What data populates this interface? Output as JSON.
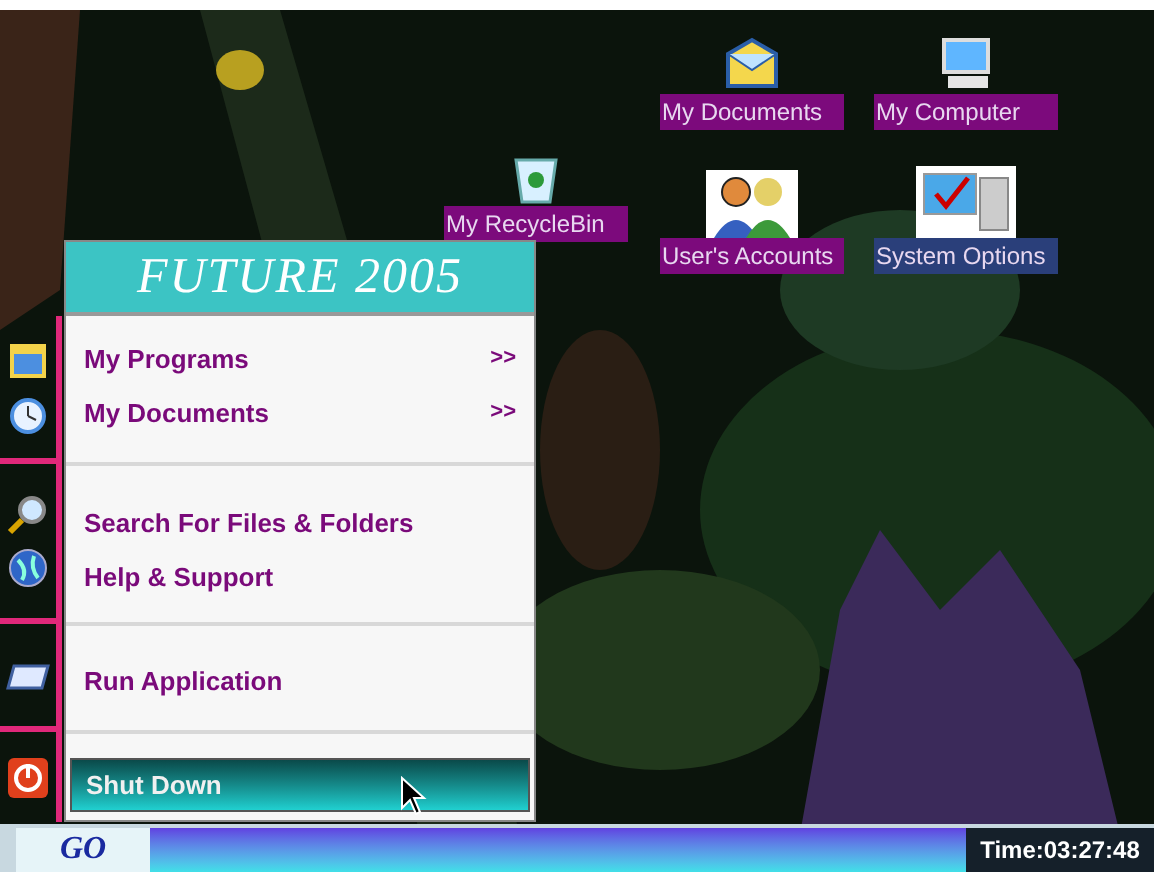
{
  "desktop_icons": [
    {
      "label": "My Documents",
      "kind": "folder",
      "selected": false
    },
    {
      "label": "My Computer",
      "kind": "computer",
      "selected": false
    },
    {
      "label": "My RecycleBin",
      "kind": "recycle",
      "selected": false
    },
    {
      "label": "User's Accounts",
      "kind": "users",
      "selected": false
    },
    {
      "label": "System Options",
      "kind": "options",
      "selected": true
    }
  ],
  "start_menu": {
    "title": "FUTURE 2005",
    "groups": [
      [
        {
          "label": "My Programs",
          "arrow": ">>",
          "kind": "calendar",
          "selected": false
        },
        {
          "label": "My Documents",
          "arrow": ">>",
          "kind": "clock",
          "selected": false
        }
      ],
      [
        {
          "label": "Search For Files & Folders",
          "kind": "search",
          "selected": false
        },
        {
          "label": "Help & Support",
          "kind": "globe",
          "selected": false
        }
      ],
      [
        {
          "label": "Run Application",
          "kind": "run",
          "selected": false
        }
      ],
      [
        {
          "label": "Shut Down",
          "kind": "power",
          "selected": true
        }
      ]
    ]
  },
  "taskbar": {
    "start_button": "GO",
    "clock": "Time:03:27:48"
  }
}
